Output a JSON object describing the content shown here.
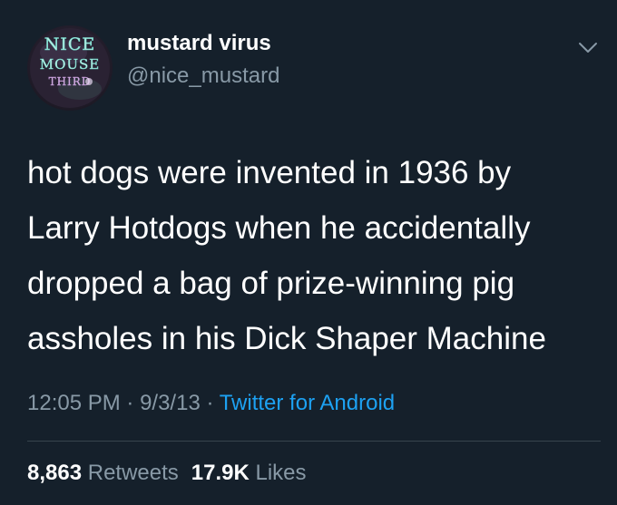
{
  "author": {
    "display_name": "mustard virus",
    "handle": "@nice_mustard",
    "avatar_text": [
      "NICE",
      "MOUSE",
      "THIRD"
    ]
  },
  "tweet": {
    "text_lines": [
      "hot dogs were invented in 1936 by",
      "Larry Hotdogs when he accidentally",
      "dropped a bag of prize-winning pig",
      "assholes in his Dick Shaper Machine"
    ],
    "time": "12:05 PM",
    "date": "9/3/13",
    "separator": " · ",
    "source": "Twitter for Android"
  },
  "stats": {
    "retweets_count": "8,863",
    "retweets_label": "Retweets",
    "likes_count": "17.9K",
    "likes_label": "Likes"
  },
  "icons": {
    "menu": "chevron-down-icon"
  },
  "colors": {
    "background": "#15202b",
    "primary_text": "#ffffff",
    "secondary_text": "#8899a6",
    "link": "#1da1f2",
    "divider": "#38444d"
  }
}
